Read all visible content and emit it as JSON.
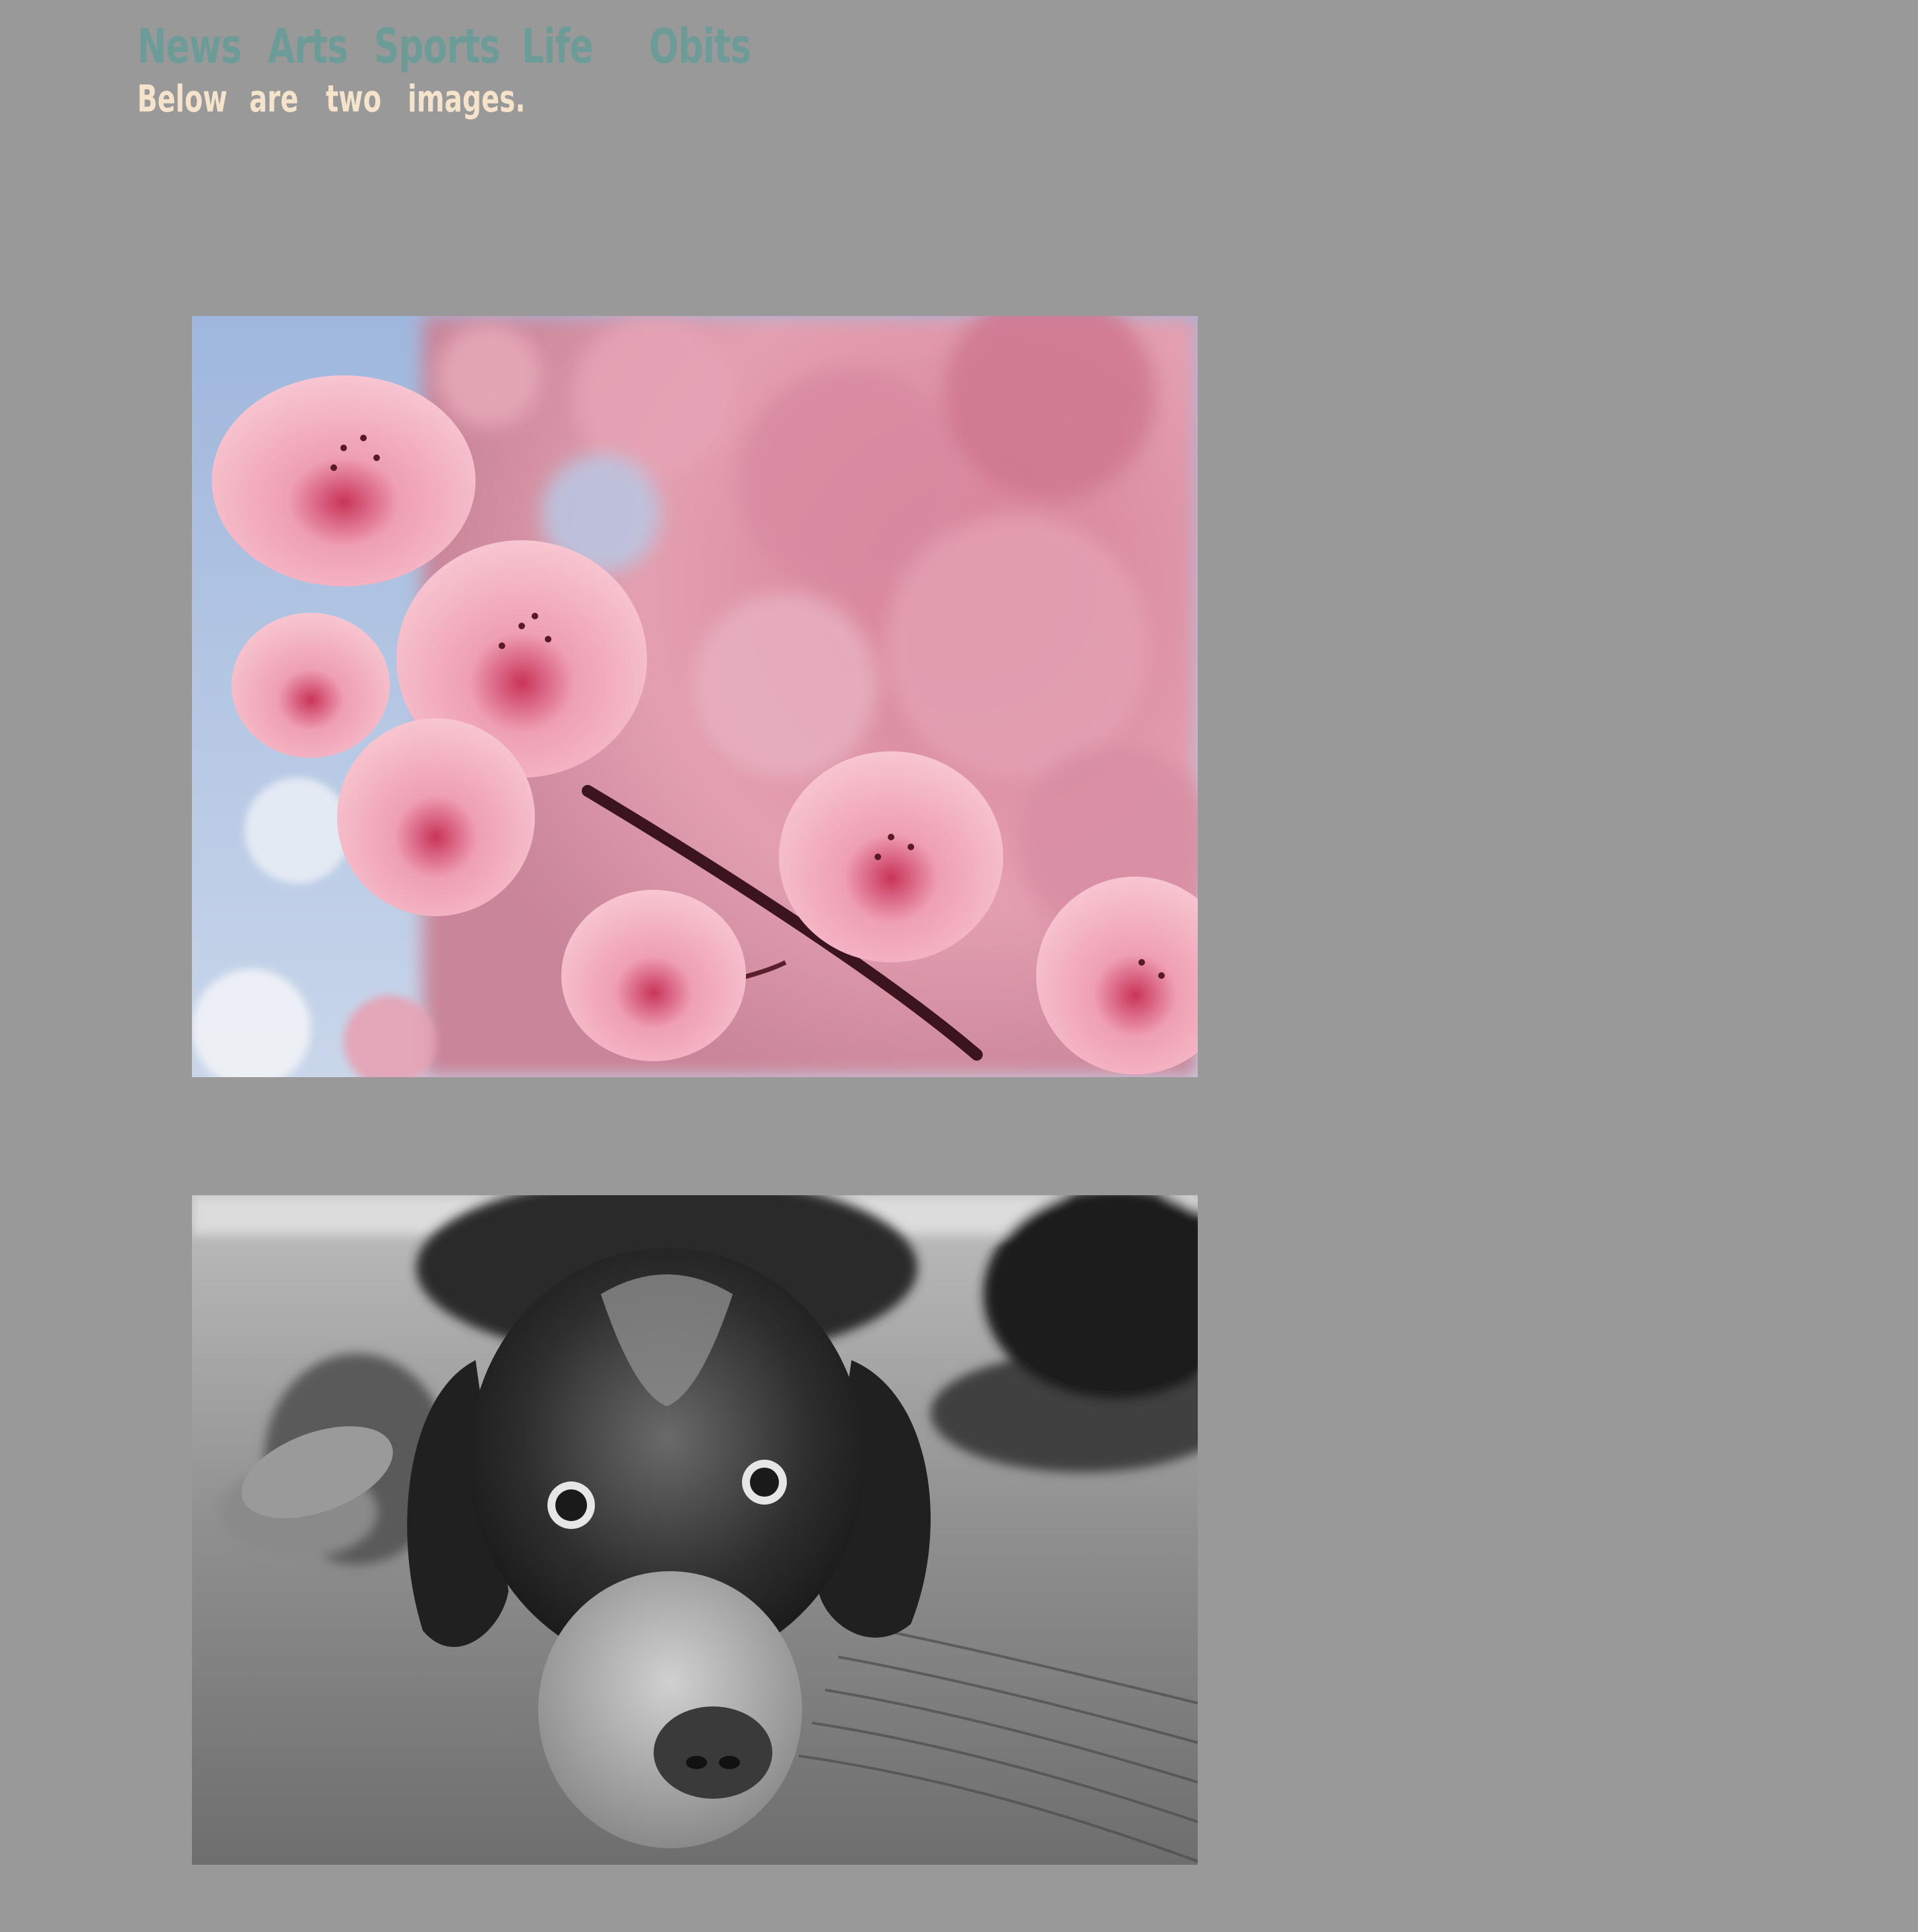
{
  "nav": {
    "items": [
      {
        "label": "News"
      },
      {
        "label": "Arts"
      },
      {
        "label": "Sports"
      },
      {
        "label": "Life"
      },
      {
        "label": "Obits"
      }
    ]
  },
  "intro": {
    "words": [
      "Below",
      "are",
      "two",
      "images."
    ]
  },
  "images": [
    {
      "subject": "pink cherry blossoms against blue sky"
    },
    {
      "subject": "black and white dog lying on a blanket"
    }
  ]
}
